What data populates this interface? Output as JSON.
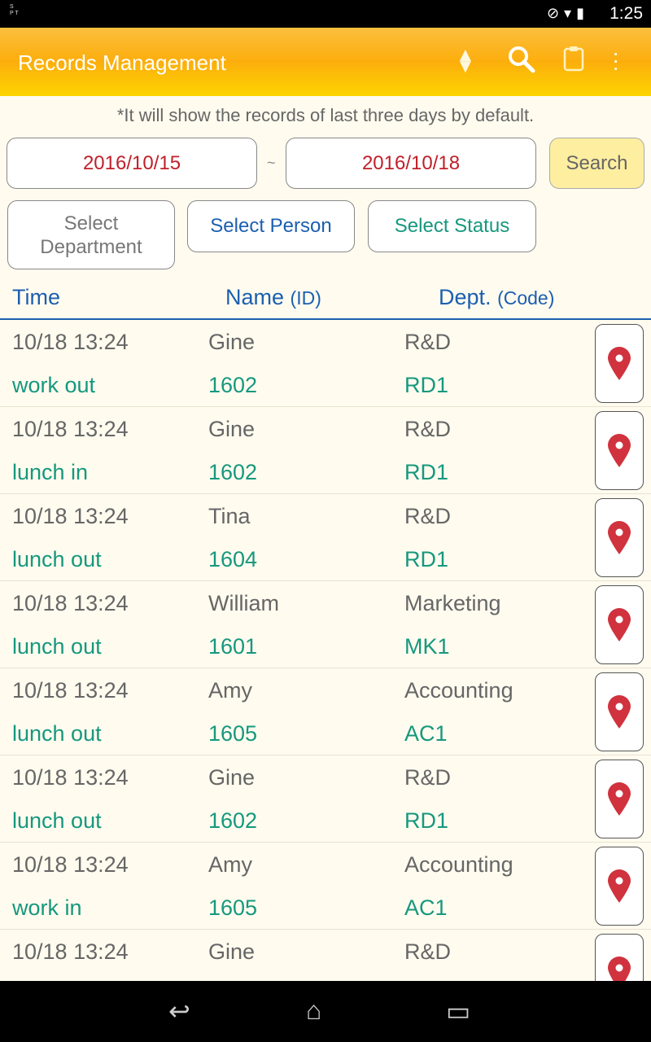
{
  "status_bar": {
    "logo": "Service Task Process",
    "time": "1:25"
  },
  "app_bar": {
    "title": "Records Management",
    "icons": [
      "sort-icon",
      "search-icon",
      "clipboard-icon",
      "more-icon"
    ]
  },
  "hint": "*It will show the records of last three days by default.",
  "filters": {
    "start_date": "2016/10/15",
    "separator": "~",
    "end_date": "2016/10/18",
    "search": "Search",
    "department": "Select Department",
    "person": "Select Person",
    "status": "Select Status"
  },
  "columns": {
    "time": "Time",
    "name": "Name",
    "id": "(ID)",
    "dept": "Dept.",
    "code": "(Code)"
  },
  "records": [
    {
      "time": "10/18 13:24",
      "name": "Gine",
      "dept": "R&D",
      "status": "work out",
      "id": "1602",
      "code": "RD1"
    },
    {
      "time": "10/18 13:24",
      "name": "Gine",
      "dept": "R&D",
      "status": "lunch in",
      "id": "1602",
      "code": "RD1"
    },
    {
      "time": "10/18 13:24",
      "name": "Tina",
      "dept": "R&D",
      "status": "lunch out",
      "id": "1604",
      "code": "RD1"
    },
    {
      "time": "10/18 13:24",
      "name": "William",
      "dept": "Marketing",
      "status": "lunch out",
      "id": "1601",
      "code": "MK1"
    },
    {
      "time": "10/18 13:24",
      "name": "Amy",
      "dept": "Accounting",
      "status": "lunch out",
      "id": "1605",
      "code": "AC1"
    },
    {
      "time": "10/18 13:24",
      "name": "Gine",
      "dept": "R&D",
      "status": "lunch out",
      "id": "1602",
      "code": "RD1"
    },
    {
      "time": "10/18 13:24",
      "name": "Amy",
      "dept": "Accounting",
      "status": "work in",
      "id": "1605",
      "code": "AC1"
    },
    {
      "time": "10/18 13:24",
      "name": "Gine",
      "dept": "R&D",
      "status": "",
      "id": "",
      "code": ""
    }
  ],
  "colors": {
    "accent": "#fcae0c",
    "header_blue": "#1c5fb0",
    "teal": "#16987e",
    "date_red": "#c0202a",
    "pin": "#d0323e"
  }
}
